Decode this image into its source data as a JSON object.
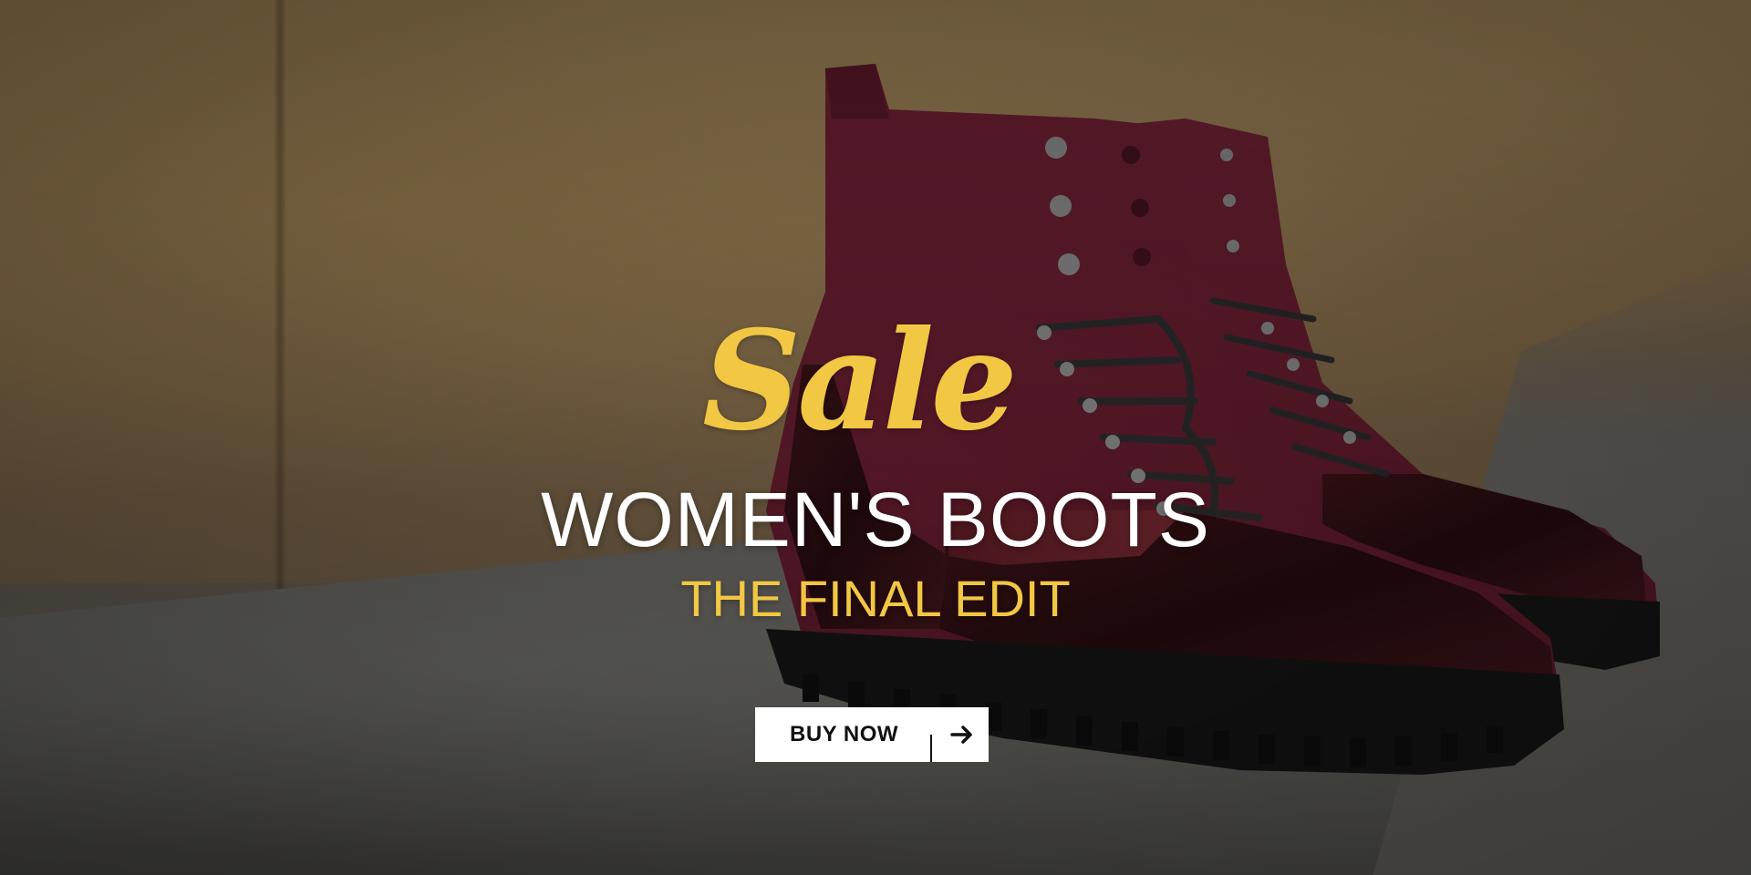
{
  "banner": {
    "script_word": "Sale",
    "title": "WOMEN'S BOOTS",
    "subtitle": "THE FINAL EDIT",
    "cta_label": "BUY NOW",
    "cta_icon": "arrow-right-icon"
  },
  "colors": {
    "accent": "#f2c744",
    "title": "#ffffff",
    "button_bg": "#ffffff",
    "button_text": "#111111",
    "boot_burgundy": "#6b1e2e",
    "boot_patent": "#2a0f12"
  }
}
